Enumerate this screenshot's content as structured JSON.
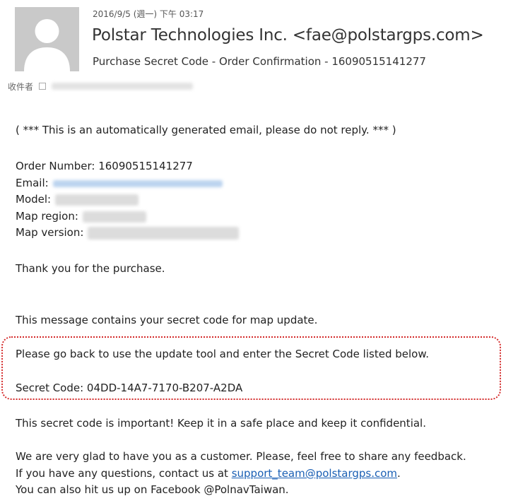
{
  "header": {
    "date": "2016/9/5 (週一) 下午 03:17",
    "from": "Polstar Technologies Inc. <fae@polstargps.com>",
    "subject": "Purchase Secret Code - Order Confirmation - 16090515141277",
    "to_label": "收件者"
  },
  "body": {
    "auto_notice": "( *** This is an automatically generated email, please do not reply. *** )",
    "order_number_label": "Order Number: 16090515141277",
    "email_label": "Email:",
    "model_label": "Model:",
    "map_region_label": "Map region:",
    "map_version_label": "Map version:",
    "thank_you": "Thank you for the purchase.",
    "contains_code": "This message contains your secret code for map update.",
    "instructions": "Please go back to use the update tool and enter the Secret Code listed below.",
    "secret_code": "Secret Code: 04DD-14A7-7170-B207-A2DA",
    "important": "This secret code is important! Keep it in a safe place and keep it confidential.",
    "glad": "We are very glad to have you as a customer. Please, feel free to share any feedback.",
    "questions_prefix": "If you have any questions, contact us at ",
    "support_email": "support_team@polstargps.com",
    "questions_suffix": ".",
    "facebook": "You can also hit us up on Facebook @PolnavTaiwan."
  },
  "colors": {
    "highlight_border": "#d42a2a",
    "link": "#1a5fb4"
  }
}
